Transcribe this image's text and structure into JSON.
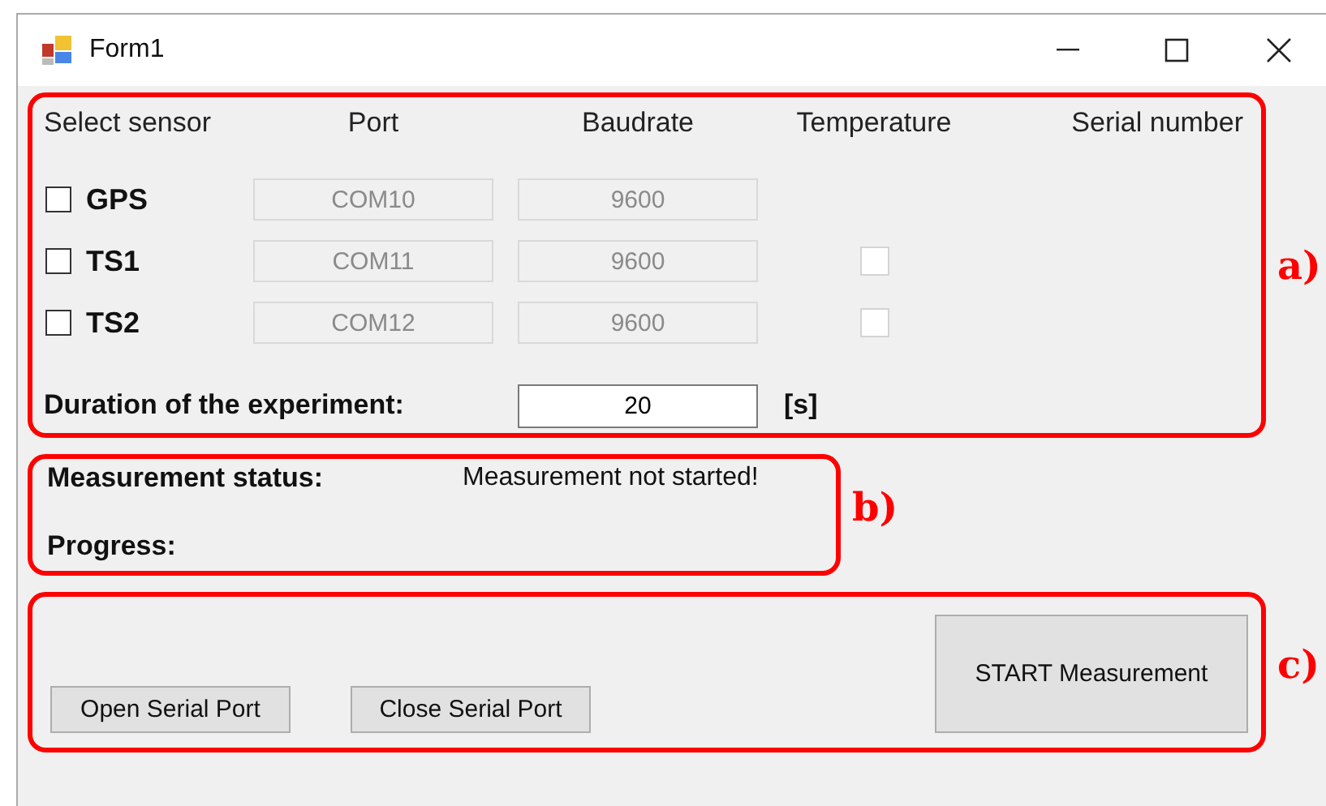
{
  "window": {
    "title": "Form1"
  },
  "sensor_section": {
    "annotation": "a)",
    "columns": [
      "Select sensor",
      "Port",
      "Baudrate",
      "Temperature",
      "Serial number"
    ],
    "sensors": [
      {
        "name": "GPS",
        "checked": false,
        "port": "COM10",
        "baudrate": "9600",
        "fields_disabled": true
      },
      {
        "name": "TS1",
        "checked": false,
        "port": "COM11",
        "baudrate": "9600",
        "fields_disabled": true,
        "temperature_checked": false
      },
      {
        "name": "TS2",
        "checked": false,
        "port": "COM12",
        "baudrate": "9600",
        "fields_disabled": true,
        "temperature_checked": false
      }
    ],
    "duration": {
      "label": "Duration of the experiment:",
      "value": "20",
      "unit": "[s]"
    }
  },
  "status_section": {
    "annotation": "b)",
    "status_label": "Measurement status:",
    "status_value": "Measurement not started!",
    "progress_label": "Progress:"
  },
  "buttons_section": {
    "annotation": "c)",
    "buttons": [
      {
        "label": "Open Serial Port",
        "kind": "small"
      },
      {
        "label": "Close Serial Port",
        "kind": "small"
      },
      {
        "label": "START Measurement",
        "kind": "large"
      }
    ]
  }
}
